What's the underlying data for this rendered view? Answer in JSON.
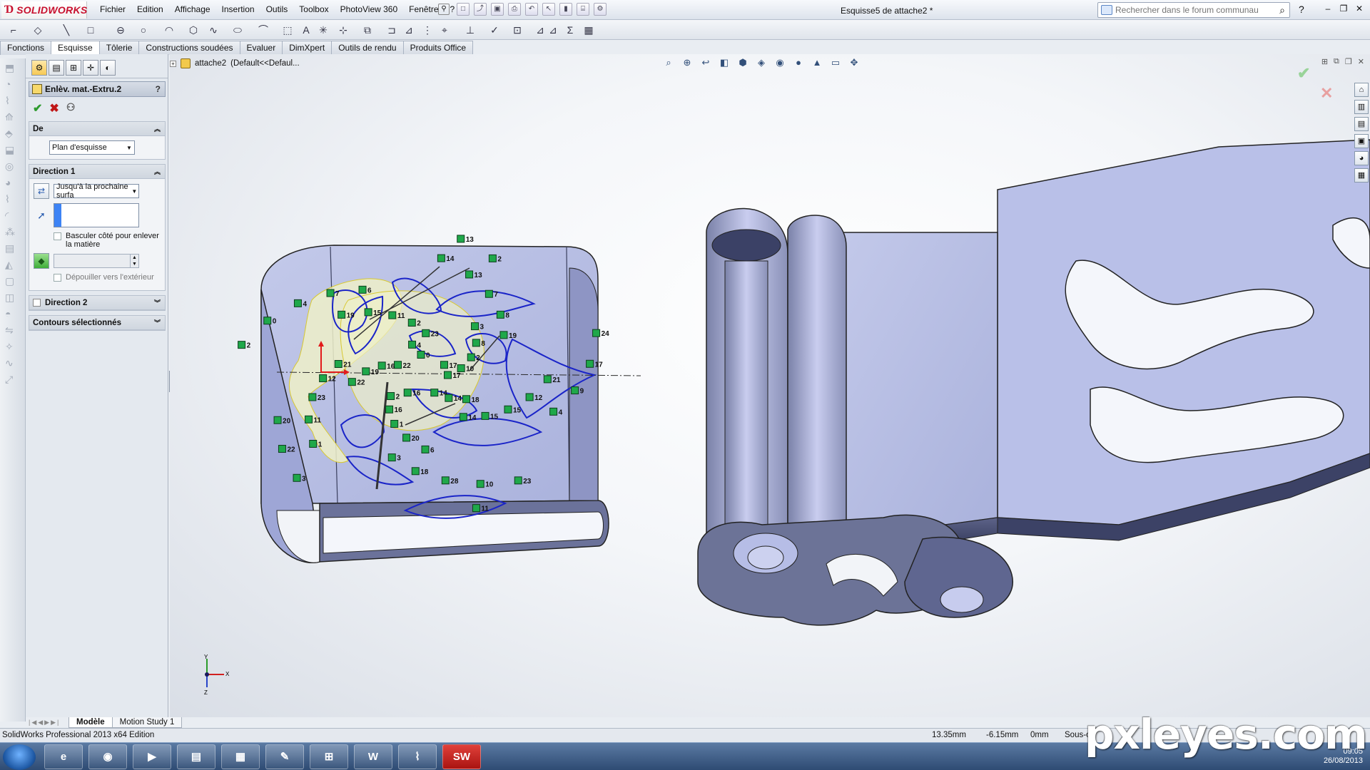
{
  "app": {
    "brand": "SOLIDWORKS",
    "document_title": "Esquisse5 de attache2 *",
    "menus": [
      "Fichier",
      "Edition",
      "Affichage",
      "Insertion",
      "Outils",
      "Toolbox",
      "PhotoView 360",
      "Fenêtre",
      "?"
    ]
  },
  "search": {
    "placeholder": "Rechercher dans le forum communautaire"
  },
  "command_tabs": [
    "Fonctions",
    "Esquisse",
    "Tôlerie",
    "Constructions soudées",
    "Evaluer",
    "DimXpert",
    "Outils de rendu",
    "Produits Office"
  ],
  "active_tab": "Esquisse",
  "property_manager": {
    "title": "Enlèv. mat.-Extru.2",
    "help": "?",
    "from_group": {
      "label": "De",
      "value": "Plan d'esquisse"
    },
    "direction1": {
      "label": "Direction 1",
      "end_condition": "Jusqu'à la prochaine surfa",
      "flip_side_label": "Basculer côté pour enlever la matière",
      "draft_outward_label": "Dépouiller vers l'extérieur"
    },
    "direction2": {
      "label": "Direction 2"
    },
    "contours": {
      "label": "Contours sélectionnés"
    }
  },
  "feature_tree": {
    "root": "attache2",
    "config": "(Default<<Defaul..."
  },
  "bottom_tabs": [
    "Modèle",
    "Motion Study 1"
  ],
  "status": {
    "edition": "SolidWorks Professional 2013 x64 Edition",
    "x": "13.35mm",
    "y": "-6.15mm",
    "z": "0mm",
    "mode": "Sous-c"
  },
  "taskbar": {
    "time": "09:05",
    "date": "26/08/2013"
  },
  "triad": {
    "x": "X",
    "y": "Y",
    "z": "Z"
  },
  "sketch_labels": [
    "17",
    "2",
    "23",
    "14",
    "21",
    "19",
    "3",
    "6",
    "4",
    "20",
    "2",
    "11",
    "22",
    "10",
    "16",
    "2",
    "15",
    "12",
    "8",
    "18",
    "7",
    "9",
    "22",
    "13",
    "14",
    "16",
    "2",
    "1",
    "11",
    "15",
    "23",
    "7",
    "28",
    "4",
    "17",
    "3",
    "0",
    "14",
    "19",
    "8",
    "20",
    "15",
    "12",
    "11",
    "13",
    "10",
    "0",
    "24",
    "16",
    "4",
    "18",
    "22",
    "3",
    "6",
    "19",
    "21",
    "1",
    "14",
    "23",
    "2",
    "17"
  ],
  "watermark": "pxleyes.com",
  "colors": {
    "part": "#b9c1e6",
    "sketch": "#1a24c8",
    "relation": "#1fa84a",
    "watermark": "#ffffff"
  }
}
